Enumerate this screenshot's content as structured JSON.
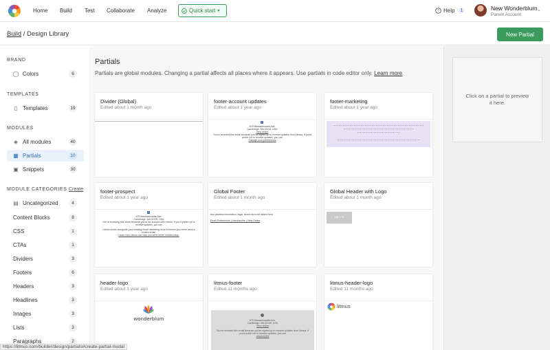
{
  "nav": {
    "links": [
      "Home",
      "Build",
      "Test",
      "Collaborate",
      "Analyze"
    ],
    "quick_start": "Quick start",
    "help": "Help",
    "help_count": "1",
    "account_name": "New Wonderblum",
    "account_role": "Parent Account"
  },
  "subheader": {
    "breadcrumb_root": "Build",
    "breadcrumb_sep": " / ",
    "breadcrumb_current": "Design Library",
    "new_partial": "New Partial"
  },
  "sidebar": {
    "brand_title": "BRAND",
    "brand_items": [
      {
        "label": "Colors",
        "count": "6"
      }
    ],
    "templates_title": "TEMPLATES",
    "templates_items": [
      {
        "label": "Templates",
        "count": "19"
      }
    ],
    "modules_title": "MODULES",
    "modules_items": [
      {
        "label": "All modules",
        "count": "40"
      },
      {
        "label": "Partials",
        "count": "10"
      },
      {
        "label": "Snippets",
        "count": "30"
      }
    ],
    "categories_title": "MODULE CATEGORIES",
    "create_label": "Create",
    "categories": [
      {
        "label": "Uncategorized",
        "count": "4"
      },
      {
        "label": "Content Blocks",
        "count": "8"
      },
      {
        "label": "CSS",
        "count": "1"
      },
      {
        "label": "CTAs",
        "count": "1"
      },
      {
        "label": "Dividers",
        "count": "3"
      },
      {
        "label": "Footers",
        "count": "6"
      },
      {
        "label": "Headers",
        "count": "3"
      },
      {
        "label": "Headlines",
        "count": "3"
      },
      {
        "label": "Images",
        "count": "3"
      },
      {
        "label": "Lists",
        "count": "3"
      },
      {
        "label": "Paragraphs",
        "count": "2"
      }
    ]
  },
  "main": {
    "title": "Partials",
    "description": "Partials are global modules. Changing a partial affects all places where it appears. Use partials in code editor only.",
    "learn_more": "Learn more",
    "cards": [
      {
        "title": "Divider (Global)",
        "edited": "Edited about 1 month ago"
      },
      {
        "title": "footer-account updates",
        "edited": "Edited about 1 year ago"
      },
      {
        "title": "footer-marketing",
        "edited": "Edited about 1 year ago"
      },
      {
        "title": "footer-prospect",
        "edited": "Edited about 1 year ago"
      },
      {
        "title": "Global Footer",
        "edited": "Edited about 1 month ago"
      },
      {
        "title": "Global Header with Logo",
        "edited": "Edited about 1 month ago"
      },
      {
        "title": "header-logo",
        "edited": "Edited about 1 year ago"
      },
      {
        "title": "litmus-footer",
        "edited": "Edited 11 months ago"
      },
      {
        "title": "litmus-header-logo",
        "edited": "Edited 11 months ago"
      }
    ],
    "thumbs": {
      "address_1": "675 Massachusetts Ave.",
      "address_2": "Cambridge, MA 02139, USA",
      "view_online": "View online",
      "account_text": "You've received this email because you've signed up to receive updates from Litmus. If you'd prefer not to receive updates, you can",
      "manage_link": "manage your preferences",
      "unsubscribe": "unsubscribe",
      "prospect_text": "You're receiving this email because you're an account with Litmus. If you'd prefer not to receive updates, you can",
      "prospect_text2": "Litmus works alongside your existing email marketing tools to ensure you never send a broken email.",
      "prospect_link": "Learn how Litmus can help you send better emails today.",
      "global_footer_text": "Any address information, legal, terms etc to be added here",
      "global_footer_links": "Email Preferences | Unsubscribe | View Online",
      "header_placeholder": "180 x 70",
      "wordmark": "wonderblum",
      "litmus_wordmark": "litmus"
    }
  },
  "preview": {
    "placeholder": "Click on a partial to preview it here."
  },
  "status_url": "https://litmus.com/builder/design/partials#create-partial-modal",
  "colors": {
    "accent_green": "#3a9b5c",
    "active_blue": "#2e6bb8",
    "marketing_purple": "#e6e1f4"
  }
}
